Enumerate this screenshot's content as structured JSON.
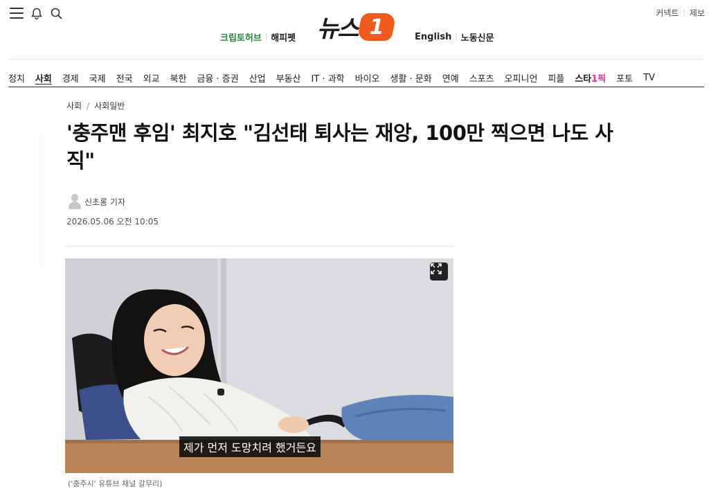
{
  "header": {
    "icons": [
      "menu-icon",
      "bell-icon",
      "search-icon"
    ],
    "top_links": [
      "커넥트",
      "제보"
    ],
    "partners_left": [
      "크립토허브",
      "해피펫"
    ],
    "logo_text": "뉴스",
    "logo_badge": "1",
    "partners_right": [
      "English",
      "노동신문"
    ],
    "colors": {
      "brand": "#ef5a1f",
      "crypto_green": "#1f8a3a",
      "star_pink": "#e0309a"
    }
  },
  "nav": {
    "items": [
      "정치",
      "사회",
      "경제",
      "국제",
      "전국",
      "외교",
      "북한",
      "금융 · 증권",
      "산업",
      "부동산",
      "IT · 과학",
      "바이오",
      "생활 · 문화",
      "연예",
      "스포츠",
      "오피니언",
      "피플"
    ],
    "star_label": "스타",
    "star_suffix": "1픽",
    "tail_items": [
      "포토",
      "TV"
    ],
    "active": "사회"
  },
  "article": {
    "breadcrumb": [
      "사회",
      "사회일반"
    ],
    "title": "'충주맨 후임' 최지호 \"김선태 퇴사는 재앙, 100만 찍으면 나도 사직\"",
    "author": "신초롱 기자",
    "date": "2026.05.06 오전 10:05",
    "image": {
      "subtitle_text": "제가 먼저 도망치려 했거든요",
      "caption": "('충주시' 유튜브 채널 갈무리)"
    }
  }
}
